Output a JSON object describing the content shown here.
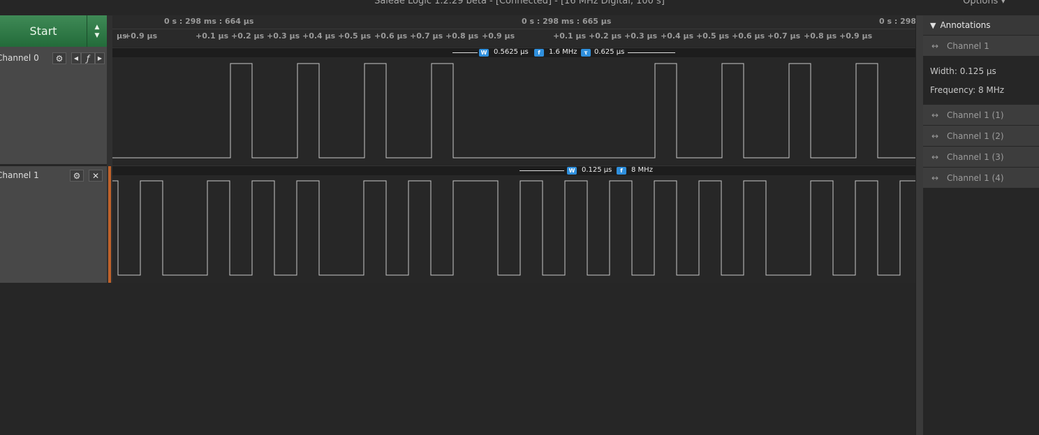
{
  "window": {
    "title": "Saleae Logic 1.2.29 beta - [Connected] - [16 MHz Digital, 100 s]",
    "options_label": "Options ▾"
  },
  "toolbar": {
    "start_label": "Start"
  },
  "channels": [
    {
      "label": "Channel 0"
    },
    {
      "label": "Channel 1"
    }
  ],
  "ruler": {
    "top_labels": [
      "0 s : 298 ms : 664 µs",
      "0 s : 298 ms : 665 µs",
      "0 s : 298"
    ],
    "ticks": [
      "µs",
      "+0.9 µs",
      "+0.1 µs",
      "+0.2 µs",
      "+0.3 µs",
      "+0.4 µs",
      "+0.5 µs",
      "+0.6 µs",
      "+0.7 µs",
      "+0.8 µs",
      "+0.9 µs",
      "+0.1 µs",
      "+0.2 µs",
      "+0.3 µs",
      "+0.4 µs",
      "+0.5 µs",
      "+0.6 µs",
      "+0.7 µs",
      "+0.8 µs",
      "+0.9 µs"
    ]
  },
  "measurements": {
    "ch0": {
      "width_icon": "W",
      "width": "0.5625 µs",
      "freq_icon": "f",
      "frequency": "1.6 MHz",
      "period_icon": "τ",
      "period": "0.625 µs"
    },
    "ch1": {
      "width_icon": "W",
      "width": "0.125 µs",
      "freq_icon": "f",
      "frequency": "8 MHz"
    }
  },
  "annotations": {
    "header": "Annotations",
    "items": [
      {
        "label": "Channel 1"
      },
      {
        "label": "Channel 1 (1)"
      },
      {
        "label": "Channel 1 (2)"
      },
      {
        "label": "Channel 1 (3)"
      },
      {
        "label": "Channel 1 (4)"
      }
    ],
    "details": {
      "width": "Width: 0.125 µs",
      "frequency": "Frequency: 8 MHz"
    }
  },
  "icons": {
    "gear": "gear-icon",
    "prev": "left-arrow-icon",
    "edge": "edge-trigger-icon",
    "next": "right-arrow-icon",
    "close": "close-icon",
    "collapse": "triangle-down-icon",
    "measure": "double-arrow-icon"
  },
  "colors": {
    "start_green": "#2f7a47",
    "marker_blue": "#2f8fdc",
    "signal": "#c8c8c8",
    "channel1_accent": "#c0622a"
  }
}
